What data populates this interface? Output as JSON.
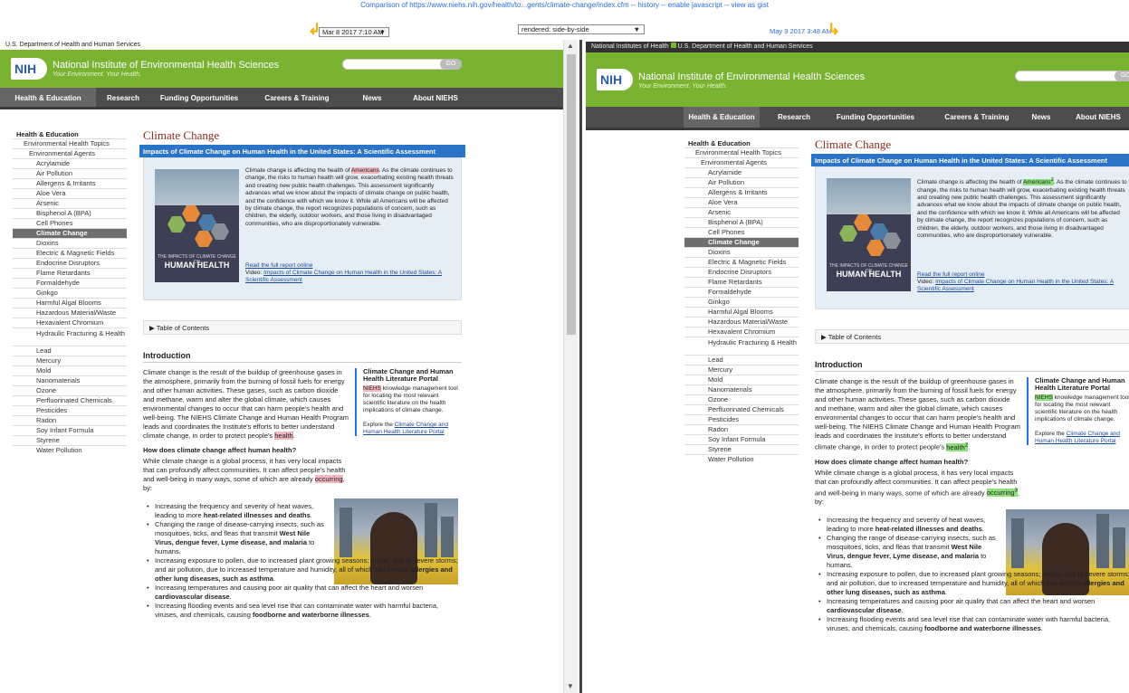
{
  "compare_bar": {
    "text": "Comparison of https://www.niehs.nih.gov/health/to...gents/climate-change/index.cfm -- history -- enable javascript -- view as gist",
    "left_date": "Mar 8 2017 7:10 AM",
    "rendered": "rendered: side-by-side",
    "right_date": "May 9 2017 3:48 AM"
  },
  "site": {
    "gov_left": "U.S. Department of Health and Human Services",
    "gov_right_nih": "National Institutes of Health",
    "gov_right_hhs": "U.S. Department of Health and Human Services",
    "logo": "NIH",
    "name": "National Institute of Environmental Health Sciences",
    "tagline": "Your Environment. Your Health.",
    "go": "GO"
  },
  "nav": [
    "Health & Education",
    "Research",
    "Funding Opportunities",
    "Careers & Training",
    "News",
    "About NIEHS"
  ],
  "sidenav": {
    "header": "Health & Education",
    "level1": "Environmental Health Topics",
    "level2": "Environmental Agents",
    "items": [
      "Acrylamide",
      "Air Pollution",
      "Allergens & Irritants",
      "Aloe Vera",
      "Arsenic",
      "Bisphenol A (BPA)",
      "Cell Phones",
      "Climate Change",
      "Dioxins",
      "Electric & Magnetic Fields",
      "Endocrine Disruptors",
      "Flame Retardants",
      "Formaldehyde",
      "Ginkgo",
      "Harmful Algal Blooms",
      "Hazardous Material/Waste",
      "Hexavalent Chromium",
      "Hydraulic Fracturing & Health",
      "Lead",
      "Mercury",
      "Mold",
      "Nanomaterials",
      "Ozone",
      "Perfluorinated Chemicals",
      "Pesticides",
      "Radon",
      "Soy Infant Formula",
      "Styrene",
      "Water Pollution"
    ],
    "active": "Climate Change"
  },
  "page": {
    "title": "Climate Change",
    "feature_title": "Impacts of Climate Change on Human Health in the United States: A Scientific Assessment",
    "cover_small": "THE IMPACTS OF CLIMATE CHANGE ON",
    "cover_big": "HUMAN HEALTH",
    "desc_pre": "Climate change is affecting the health of ",
    "desc_hl": "Americans",
    "desc_post": ". As the climate continues to change, the risks to human health will grow, exacerbating existing health threats and creating new public health challenges. This assessment significantly advances what we know about the impacts of climate change on public health, and the confidence with which we know it. While all Americans will be affected by climate change, the report recognizes populations of concern, such as children, the elderly, outdoor workers, and those living in disadvantaged communities, who are disproportionately vulnerable.",
    "link_report": "Read the full report online",
    "video_label": "Video: ",
    "video_link": "Impacts of Climate Change on Human Health in the United States: A Scientific Assessment",
    "toc": "Table of Contents",
    "intro_title": "Introduction",
    "intro_pre": "Climate change is the result of the buildup of greenhouse gases in the atmosphere, primarily from the burning of fossil fuels for energy and other human activities. These gases, such as carbon dioxide and methane, warm and alter the global climate, which causes environmental changes to occur that can harm people's health and well-being. The NIEHS Climate Change and Human Health Program leads and coordinates the Institute's efforts to better understand climate change, in order to protect people's ",
    "intro_hl": "health",
    "intro_post": ".",
    "aside_title": "Climate Change and Human Health Literature Portal",
    "aside_hl": "NIEHS",
    "aside_text": " knowledge management tool for locating the most relevant scientific literature on the health implications of climate change.",
    "aside_explore": "Explore the ",
    "aside_link": "Climate Change and Human Health Literature Portal",
    "question": "How does climate change affect human health?",
    "para2_pre": "While climate change is a global process, it has very local impacts that can profoundly affect communities. It can affect people's health and well-being in many ways, some of which are already ",
    "para2_hl": "occurring",
    "para2_post": ", by:",
    "bullets": [
      {
        "pre": "Increasing the frequency and severity of heat waves, leading to more ",
        "bold": "heat-related illnesses and deaths",
        "post": "."
      },
      {
        "pre": "Changing the range of disease-carrying insects, such as mosquitoes, ticks, and fleas that transmit ",
        "bold": "West Nile Virus, dengue fever, Lyme disease, and malaria",
        "post": " to humans."
      },
      {
        "pre": "Increasing exposure to pollen, due to increased plant growing seasons; molds, due to severe storms; and air pollution, due to increased temperature and humidity, all of which can worsen ",
        "bold": "allergies and other lung diseases, such as asthma",
        "post": "."
      },
      {
        "pre": "Increasing temperatures and causing poor air quality that can affect the heart and worsen ",
        "bold": "cardiovascular disease",
        "post": "."
      },
      {
        "pre": "Increasing flooding events and sea level rise that can contaminate water with harmful bacteria, viruses, and chemicals, causing ",
        "bold": "foodborne and waterborne illnesses",
        "post": "."
      }
    ]
  },
  "right_markers": {
    "americans": "2",
    "health": "2",
    "occurring": "3"
  },
  "colors": {
    "nih_green": "#7ab232",
    "nav_dark": "#4d4d4d",
    "feature_blue": "#2a73c7",
    "title_red": "#8b2b1a",
    "diff_removed": "#f4b8c0",
    "diff_added": "#8ee07a"
  }
}
